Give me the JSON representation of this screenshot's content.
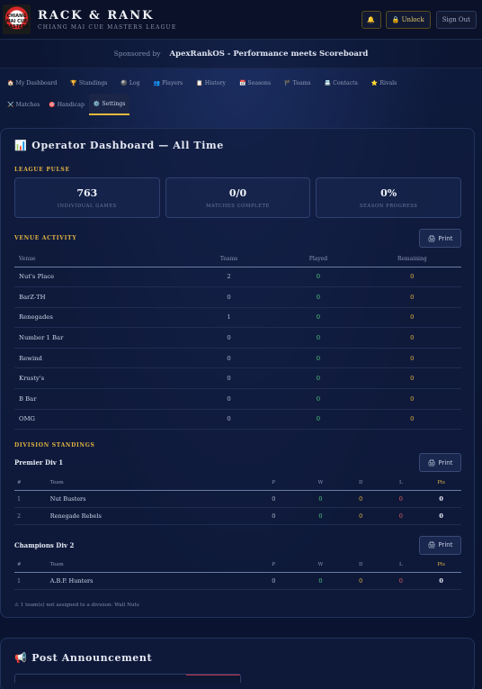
{
  "header": {
    "title": "RACK & RANK",
    "subtitle": "CHIANG MAI CUE MASTERS LEAGUE",
    "logo_text": "CHIANG MAI CUE MASTERS",
    "bell_icon": "bell-icon",
    "unlock_label": "🔒 Unlock",
    "signout_label": "Sign Out"
  },
  "sponsor": {
    "label": "Sponsored by",
    "name": "ApexRankOS - Performance meets Scoreboard"
  },
  "nav": {
    "row1": [
      {
        "icon": "🏠",
        "label": "My Dashboard"
      },
      {
        "icon": "🏆",
        "label": "Standings"
      },
      {
        "icon": "🎱",
        "label": "Log"
      },
      {
        "icon": "👥",
        "label": "Players"
      },
      {
        "icon": "📋",
        "label": "History"
      },
      {
        "icon": "📅",
        "label": "Seasons"
      },
      {
        "icon": "🏴",
        "label": "Teams"
      },
      {
        "icon": "📇",
        "label": "Contacts"
      },
      {
        "icon": "⭐",
        "label": "Rivals"
      }
    ],
    "row2": [
      {
        "icon": "⚔️",
        "label": "Matches"
      },
      {
        "icon": "🎯",
        "label": "Handicap"
      },
      {
        "icon": "⚙️",
        "label": "Settings",
        "active": true
      }
    ]
  },
  "dashboard": {
    "title_icon": "📊",
    "title": "Operator Dashboard — All Time",
    "league_pulse_label": "LEAGUE PULSE",
    "stats": [
      {
        "value": "763",
        "label": "INDIVIDUAL GAMES"
      },
      {
        "value": "0/0",
        "label": "MATCHES COMPLETE"
      },
      {
        "value": "0%",
        "label": "SEASON PROGRESS"
      }
    ],
    "venue_activity_label": "VENUE ACTIVITY",
    "print_label": "Print",
    "print_icon": "🖨",
    "venue_headers": [
      "Venue",
      "Teams",
      "Played",
      "Remaining"
    ],
    "venues": [
      {
        "name": "Nut's Place",
        "teams": "2",
        "played": "0",
        "remaining": "0"
      },
      {
        "name": "BarZ-TH",
        "teams": "0",
        "played": "0",
        "remaining": "0"
      },
      {
        "name": "Renegades",
        "teams": "1",
        "played": "0",
        "remaining": "0"
      },
      {
        "name": "Number 1 Bar",
        "teams": "0",
        "played": "0",
        "remaining": "0"
      },
      {
        "name": "Rewind",
        "teams": "0",
        "played": "0",
        "remaining": "0"
      },
      {
        "name": "Krusty's",
        "teams": "0",
        "played": "0",
        "remaining": "0"
      },
      {
        "name": "B Bar",
        "teams": "0",
        "played": "0",
        "remaining": "0"
      },
      {
        "name": "OMG",
        "teams": "0",
        "played": "0",
        "remaining": "0"
      }
    ],
    "division_standings_label": "DIVISION STANDINGS",
    "standing_headers": [
      "#",
      "Team",
      "P",
      "W",
      "D",
      "L",
      "Pts"
    ],
    "divisions": [
      {
        "name": "Premier Div 1",
        "rows": [
          {
            "pos": "1",
            "team": "Nut Busters",
            "p": "0",
            "w": "0",
            "d": "0",
            "l": "0",
            "pts": "0"
          },
          {
            "pos": "2",
            "team": "Renegade Rebels",
            "p": "0",
            "w": "0",
            "d": "0",
            "l": "0",
            "pts": "0"
          }
        ]
      },
      {
        "name": "Champions Div 2",
        "rows": [
          {
            "pos": "1",
            "team": "A.B.P. Hunters",
            "p": "0",
            "w": "0",
            "d": "0",
            "l": "0",
            "pts": "0"
          }
        ]
      }
    ],
    "note": "⚠ 1 team(s) not assigned to a division: Wall Nuts"
  },
  "announcement": {
    "icon": "📢",
    "title": "Post Announcement"
  },
  "colors": {
    "accent_gold": "#e1b343",
    "win_green": "#4ec47c",
    "loss_red": "#e25b5b",
    "background": "#0b1530"
  }
}
